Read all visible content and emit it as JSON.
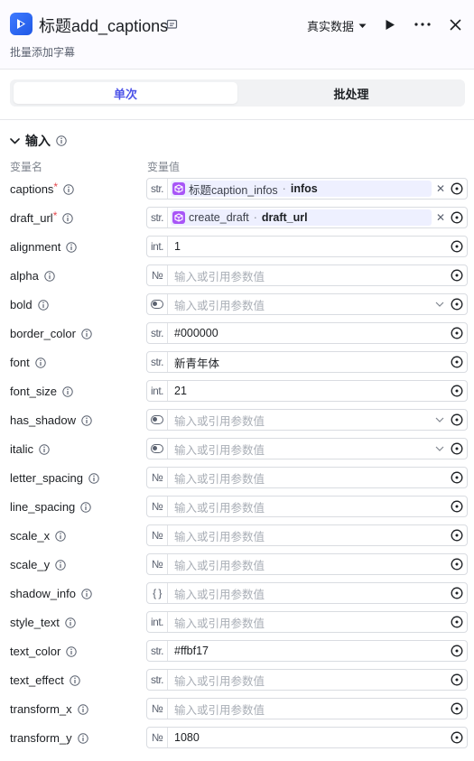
{
  "header": {
    "title": "标题add_captions",
    "subtitle": "批量添加字幕",
    "data_mode": "真实数据",
    "accent": "#4d53e8"
  },
  "tabs": [
    {
      "label": "单次",
      "active": true
    },
    {
      "label": "批处理",
      "active": false
    }
  ],
  "section": {
    "title": "输入",
    "col_name": "变量名",
    "col_value": "变量值"
  },
  "params": [
    {
      "name": "captions",
      "required": true,
      "type": "str.",
      "kind": "ref",
      "ref_node": "标题caption_infos",
      "ref_var": "infos"
    },
    {
      "name": "draft_url",
      "required": true,
      "type": "str.",
      "kind": "ref",
      "ref_node": "create_draft",
      "ref_var": "draft_url"
    },
    {
      "name": "alignment",
      "type": "int.",
      "kind": "value",
      "value": "1"
    },
    {
      "name": "alpha",
      "type": "№",
      "kind": "placeholder",
      "value": "输入或引用参数值"
    },
    {
      "name": "bold",
      "type": "toggle",
      "kind": "select",
      "value": "输入或引用参数值"
    },
    {
      "name": "border_color",
      "type": "str.",
      "kind": "value",
      "value": "#000000"
    },
    {
      "name": "font",
      "type": "str.",
      "kind": "value",
      "value": "新青年体"
    },
    {
      "name": "font_size",
      "type": "int.",
      "kind": "value",
      "value": "21"
    },
    {
      "name": "has_shadow",
      "type": "toggle",
      "kind": "select",
      "value": "输入或引用参数值"
    },
    {
      "name": "italic",
      "type": "toggle",
      "kind": "select",
      "value": "输入或引用参数值"
    },
    {
      "name": "letter_spacing",
      "type": "№",
      "kind": "placeholder",
      "value": "输入或引用参数值"
    },
    {
      "name": "line_spacing",
      "type": "№",
      "kind": "placeholder",
      "value": "输入或引用参数值"
    },
    {
      "name": "scale_x",
      "type": "№",
      "kind": "placeholder",
      "value": "输入或引用参数值"
    },
    {
      "name": "scale_y",
      "type": "№",
      "kind": "placeholder",
      "value": "输入或引用参数值"
    },
    {
      "name": "shadow_info",
      "type": "{ }",
      "kind": "placeholder",
      "value": "输入或引用参数值"
    },
    {
      "name": "style_text",
      "type": "int.",
      "kind": "placeholder",
      "value": "输入或引用参数值"
    },
    {
      "name": "text_color",
      "type": "str.",
      "kind": "value",
      "value": "#ffbf17"
    },
    {
      "name": "text_effect",
      "type": "str.",
      "kind": "placeholder",
      "value": "输入或引用参数值"
    },
    {
      "name": "transform_x",
      "type": "№",
      "kind": "placeholder",
      "value": "输入或引用参数值"
    },
    {
      "name": "transform_y",
      "type": "№",
      "kind": "value",
      "value": "1080"
    }
  ]
}
